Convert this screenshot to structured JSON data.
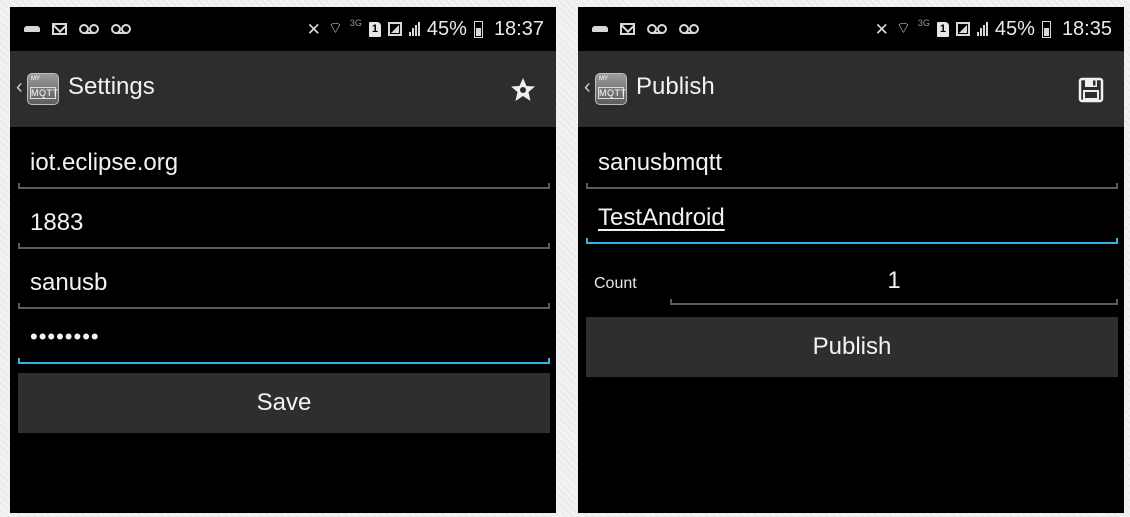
{
  "settings_screen": {
    "status_bar": {
      "battery": "45%",
      "network": "3G",
      "sim": "1",
      "time": "18:37"
    },
    "app_icon_text": {
      "top": "MY",
      "bottom": "MQTT"
    },
    "title": "Settings",
    "action_icon": "star-settings-icon",
    "fields": {
      "host": "iot.eclipse.org",
      "port": "1883",
      "username": "sanusb",
      "password": "••••••••"
    },
    "save_label": "Save"
  },
  "publish_screen": {
    "status_bar": {
      "battery": "45%",
      "network": "3G",
      "sim": "1",
      "time": "18:35"
    },
    "app_icon_text": {
      "top": "MY",
      "bottom": "MQTT"
    },
    "title": "Publish",
    "action_icon": "save-icon",
    "fields": {
      "topic": "sanusbmqtt",
      "message": "TestAndroid"
    },
    "count_label": "Count",
    "count_value": "1",
    "publish_label": "Publish"
  },
  "colors": {
    "background": "#000000",
    "action_bar": "#2d2d2d",
    "button": "#2e2e2e",
    "focus_accent": "#33b5e5",
    "field_line": "#5a5a5a",
    "text": "#f2f2f2"
  }
}
